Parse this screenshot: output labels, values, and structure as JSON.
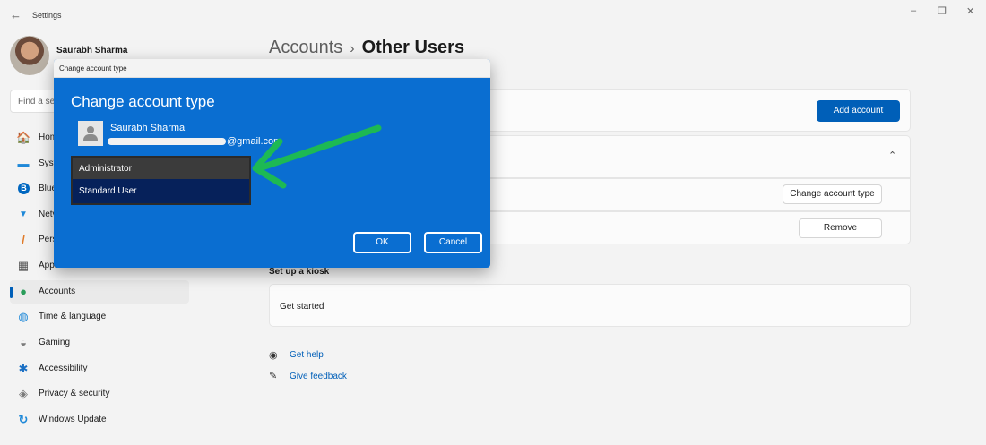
{
  "window": {
    "back_glyph": "←",
    "title": "Settings",
    "controls": [
      "–",
      "❐",
      "✕"
    ]
  },
  "profile": {
    "name": "Saurabh Sharma"
  },
  "search": {
    "placeholder": "Find a set"
  },
  "sidebar": {
    "items": [
      {
        "label": "Hom",
        "icon": "home-icon",
        "glyph": "🏠",
        "color": "#e0803a"
      },
      {
        "label": "Syst",
        "icon": "system-icon",
        "glyph": "▬",
        "color": "#1e88d8"
      },
      {
        "label": "Blue",
        "icon": "bluetooth-icon",
        "glyph": "B",
        "color": "#0067c0"
      },
      {
        "label": "Netv",
        "icon": "network-icon",
        "glyph": "▼",
        "color": "#1e88d8"
      },
      {
        "label": "Pers",
        "icon": "personalization-icon",
        "glyph": "/",
        "color": "#e07b2a"
      },
      {
        "label": "Apps",
        "icon": "apps-icon",
        "glyph": "▦",
        "color": "#555555"
      },
      {
        "label": "Accounts",
        "icon": "accounts-icon",
        "glyph": "●",
        "color": "#2a9d5a",
        "active": true
      },
      {
        "label": "Time & language",
        "icon": "globe-icon",
        "glyph": "◍",
        "color": "#1e88d8"
      },
      {
        "label": "Gaming",
        "icon": "gaming-icon",
        "glyph": "◒",
        "color": "#7a7a7a"
      },
      {
        "label": "Accessibility",
        "icon": "accessibility-icon",
        "glyph": "✱",
        "color": "#1a6fc4"
      },
      {
        "label": "Privacy & security",
        "icon": "shield-icon",
        "glyph": "◈",
        "color": "#7a7a7a"
      },
      {
        "label": "Windows Update",
        "icon": "update-icon",
        "glyph": "↻",
        "color": "#1e88d8"
      }
    ]
  },
  "breadcrumb": {
    "parent": "Accounts",
    "separator": "›",
    "current": "Other Users"
  },
  "main": {
    "add_account_label": "Add account",
    "chevron_up": "⌃",
    "change_type_label": "Change account type",
    "remove_label": "Remove",
    "kiosk_title": "Set up a kiosk",
    "kiosk_row": "Get started",
    "get_help": "Get help",
    "give_feedback": "Give feedback"
  },
  "dialog": {
    "window_title": "Change account type",
    "heading": "Change account type",
    "user_name": "Saurabh Sharma",
    "email_suffix": "@gmail.com",
    "options": [
      "Administrator",
      "Standard User"
    ],
    "selected_option": "Administrator",
    "ok_label": "OK",
    "cancel_label": "Cancel"
  },
  "colors": {
    "accent": "#005fb8",
    "dialog_bg": "#0a6ed1",
    "annotation_arrow": "#1db954"
  }
}
